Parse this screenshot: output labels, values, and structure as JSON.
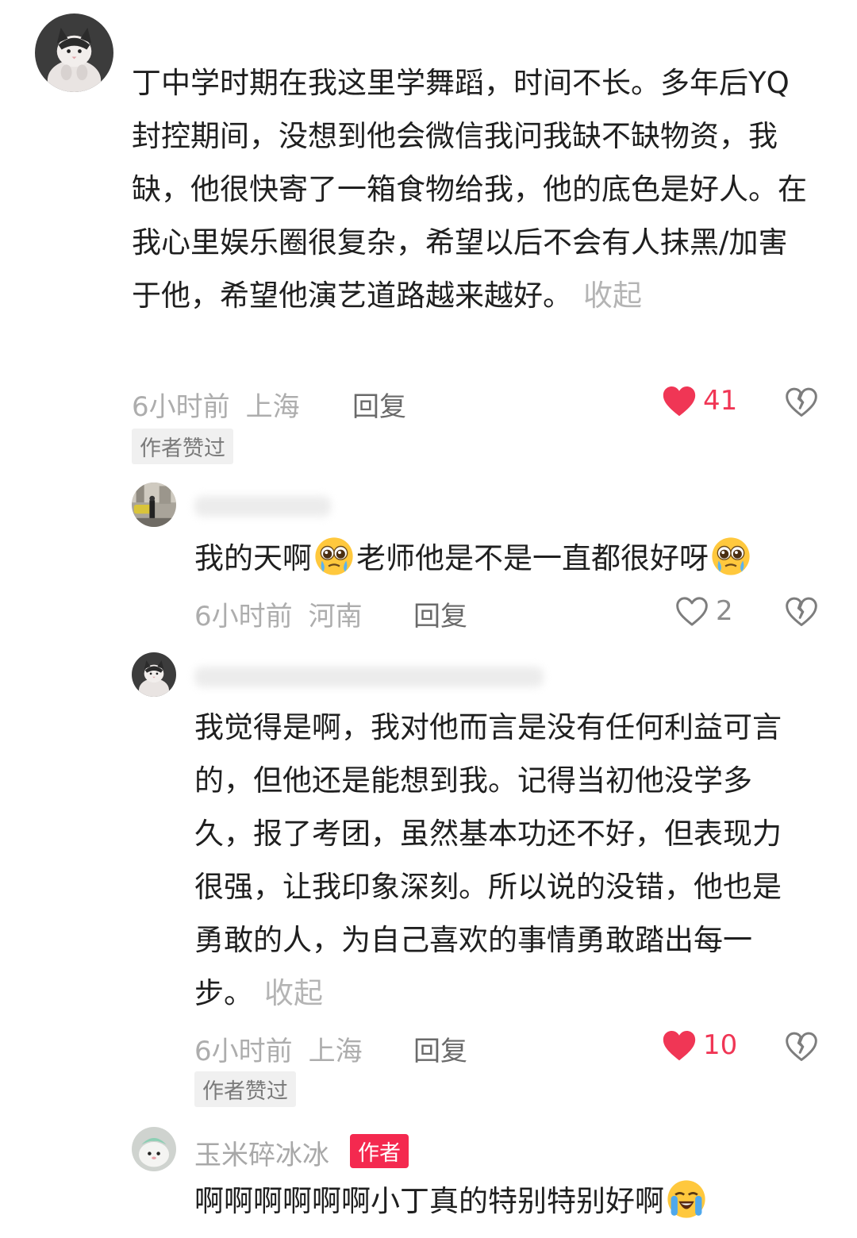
{
  "comments": [
    {
      "text": "丁中学时期在我这里学舞蹈，时间不长。多年后YQ封控期间，没想到他会微信我问我缺不缺物资，我缺，他很快寄了一箱食物给我，他的底色是好人。在我心里娱乐圈很复杂，希望以后不会有人抹黑/加害于他，希望他演艺道路越来越好。",
      "collapse_label": "收起",
      "time": "6小时前",
      "location": "上海",
      "reply_label": "回复",
      "likes": "41",
      "liked": true,
      "badge": "作者赞过"
    }
  ],
  "replies": [
    {
      "text_parts": [
        "我的天啊",
        "老师他是不是一直都很好呀"
      ],
      "emoji": "pleading-face-icon",
      "time": "6小时前",
      "location": "河南",
      "reply_label": "回复",
      "likes": "2",
      "liked": false
    },
    {
      "text": "我觉得是啊，我对他而言是没有任何利益可言的，但他还是能想到我。记得当初他没学多久，报了考团，虽然基本功还不好，但表现力很强，让我印象深刻。所以说的没错，他也是勇敢的人，为自己喜欢的事情勇敢踏出每一步。",
      "collapse_label": "收起",
      "time": "6小时前",
      "location": "上海",
      "reply_label": "回复",
      "likes": "10",
      "liked": true,
      "badge": "作者赞过"
    },
    {
      "username": "玉米碎冰冰",
      "author_tag": "作者",
      "text": "啊啊啊啊啊啊小丁真的特别特别好啊",
      "emoji": "loudly-crying-face-icon"
    }
  ],
  "colors": {
    "like_active": "#f03655",
    "author_tag": "#f4294f",
    "meta_gray": "#adadad"
  }
}
